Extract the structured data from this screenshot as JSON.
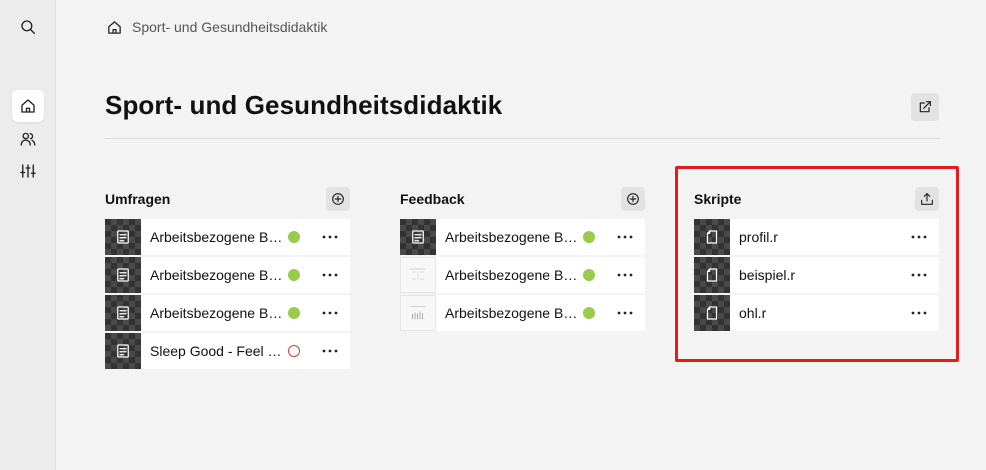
{
  "breadcrumb": {
    "label": "Sport- und Gesundheitsdidaktik"
  },
  "page": {
    "title": "Sport- und Gesundheitsdidaktik"
  },
  "colors": {
    "status_ok": "#98cc4a",
    "status_off": "#e03a3a",
    "highlight": "#e41b1b"
  },
  "sidebar": {
    "items": [
      {
        "name": "search-icon"
      },
      {
        "name": "home-icon",
        "active": true
      },
      {
        "name": "users-icon"
      },
      {
        "name": "sliders-icon"
      }
    ]
  },
  "columns": [
    {
      "title": "Umfragen",
      "action_icon": "plus-circle-icon",
      "items": [
        {
          "label": "Arbeitsbezogene Belastungen im Lehramt",
          "status": "ok"
        },
        {
          "label": "Arbeitsbezogene Belastungen im Lehramt",
          "status": "ok"
        },
        {
          "label": "Arbeitsbezogene Belastungen im Lehramt",
          "status": "ok"
        },
        {
          "label": "Sleep Good - Feel Good",
          "status": "off"
        }
      ]
    },
    {
      "title": "Feedback",
      "action_icon": "plus-circle-icon",
      "items": [
        {
          "label": "Arbeitsbezogene Belastungen im Lehramt",
          "status": "ok"
        },
        {
          "label": "Arbeitsbezogene Belastungen im Lehramt",
          "status": "ok"
        },
        {
          "label": "Arbeitsbezogene Belastungen im Lehramt",
          "status": "ok"
        }
      ]
    },
    {
      "title": "Skripte",
      "action_icon": "upload-icon",
      "items": [
        {
          "label": "profil.r"
        },
        {
          "label": "beispiel.r"
        },
        {
          "label": "ohl.r"
        }
      ]
    }
  ]
}
